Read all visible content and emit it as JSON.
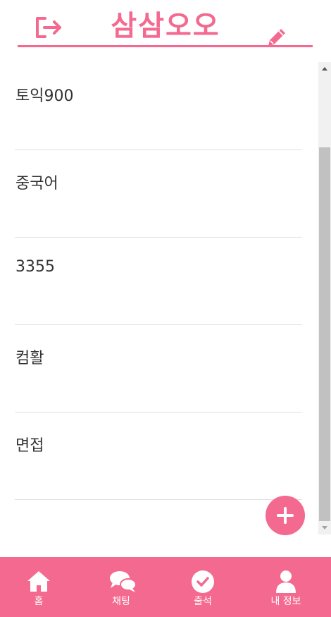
{
  "header": {
    "title": "삼삼오오",
    "logout_icon": "logout-icon",
    "edit_icon": "pencil-icon"
  },
  "list": {
    "items": [
      {
        "label": "토익900"
      },
      {
        "label": "중국어"
      },
      {
        "label": "3355"
      },
      {
        "label": "컴활"
      },
      {
        "label": "면접"
      }
    ]
  },
  "fab": {
    "icon": "plus-icon"
  },
  "nav": {
    "items": [
      {
        "label": "홈",
        "icon": "home-icon"
      },
      {
        "label": "채팅",
        "icon": "chat-icon"
      },
      {
        "label": "출석",
        "icon": "check-circle-icon"
      },
      {
        "label": "내 정보",
        "icon": "user-icon"
      }
    ]
  },
  "colors": {
    "accent": "#f4698f",
    "divider": "#e0e0e0",
    "scrollbar_thumb": "#c1c1c1"
  }
}
